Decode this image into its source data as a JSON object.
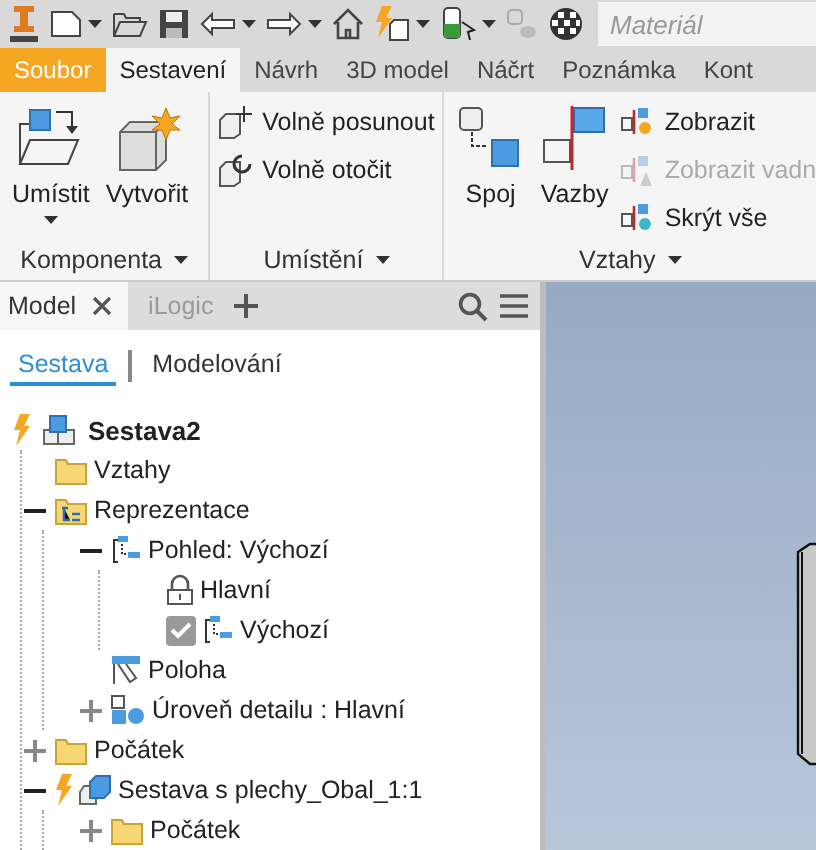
{
  "quick_access": {
    "material": {
      "placeholder": "Materiál"
    }
  },
  "ribbon_tabs": [
    {
      "label": "Soubor",
      "kind": "file",
      "selected": false
    },
    {
      "label": "Sestavení",
      "kind": "tab",
      "selected": true
    },
    {
      "label": "Návrh",
      "kind": "tab",
      "selected": false
    },
    {
      "label": "3D model",
      "kind": "tab",
      "selected": false
    },
    {
      "label": "Náčrt",
      "kind": "tab",
      "selected": false
    },
    {
      "label": "Poznámka",
      "kind": "tab",
      "selected": false
    },
    {
      "label": "Kont",
      "kind": "tab",
      "selected": false
    }
  ],
  "ribbon_panels": [
    {
      "title": "Komponenta",
      "buttons": [
        {
          "label": "Umístit",
          "kind": "large",
          "dropdown": true
        },
        {
          "label": "Vytvořit",
          "kind": "large"
        }
      ]
    },
    {
      "title": "Umístění",
      "buttons": [
        {
          "label": "Volně posunout",
          "kind": "small",
          "disabled": false
        },
        {
          "label": "Volně otočit",
          "kind": "small",
          "disabled": false
        }
      ]
    },
    {
      "title": "Vztahy",
      "buttons": [
        {
          "label": "Spoj",
          "kind": "large"
        },
        {
          "label": "Vazby",
          "kind": "large"
        },
        {
          "label": "Zobrazit",
          "kind": "small",
          "disabled": false
        },
        {
          "label": "Zobrazit vadn",
          "kind": "small",
          "disabled": true
        },
        {
          "label": "Skrýt vše",
          "kind": "small",
          "disabled": false
        }
      ]
    }
  ],
  "browser": {
    "tabs": [
      {
        "label": "Model",
        "selected": true
      },
      {
        "label": "iLogic",
        "selected": false
      }
    ],
    "modes": [
      {
        "label": "Sestava",
        "selected": true
      },
      {
        "label": "Modelování",
        "selected": false
      }
    ],
    "tree": {
      "label": "Sestava2",
      "kind": "assembly",
      "active": true,
      "children": [
        {
          "label": "Vztahy",
          "kind": "folder"
        },
        {
          "label": "Reprezentace",
          "kind": "representation",
          "expanded": true,
          "children": [
            {
              "label": "Pohled: Výchozí",
              "kind": "view",
              "expanded": true,
              "children": [
                {
                  "label": "Hlavní",
                  "kind": "lock"
                },
                {
                  "label": "Výchozí",
                  "kind": "view",
                  "checked": true
                }
              ]
            },
            {
              "label": "Poloha",
              "kind": "position"
            },
            {
              "label": "Úroveň detailu : Hlavní",
              "kind": "detail",
              "expanded": false
            }
          ]
        },
        {
          "label": "Počátek",
          "kind": "folder",
          "expanded": false
        },
        {
          "label": "Sestava s plechy_Obal_1:1",
          "kind": "subassembly",
          "active": true,
          "expanded": true,
          "children": [
            {
              "label": "Počátek",
              "kind": "folder",
              "expanded": false
            }
          ]
        }
      ]
    }
  }
}
